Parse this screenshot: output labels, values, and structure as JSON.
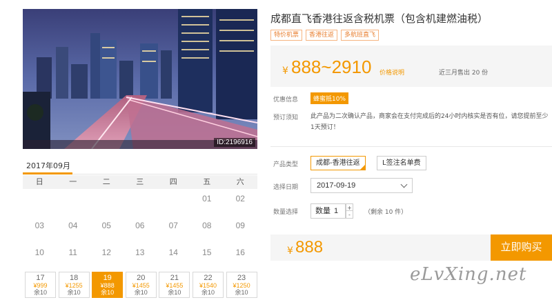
{
  "hero": {
    "image_id": "ID:2196916"
  },
  "calendar": {
    "month": "2017年09月",
    "weekdays": [
      "日",
      "一",
      "二",
      "三",
      "四",
      "五",
      "六"
    ],
    "rows": [
      [
        "",
        "",
        "",
        "",
        "",
        "01",
        "02"
      ],
      [
        "03",
        "04",
        "05",
        "06",
        "07",
        "08",
        "09"
      ],
      [
        "10",
        "11",
        "12",
        "13",
        "14",
        "15",
        "16"
      ]
    ],
    "price_days": [
      {
        "day": "17",
        "price": "¥999",
        "remain": "余10"
      },
      {
        "day": "18",
        "price": "¥1255",
        "remain": "余10"
      },
      {
        "day": "19",
        "price": "¥888",
        "remain": "余10"
      },
      {
        "day": "20",
        "price": "¥1455",
        "remain": "余10"
      },
      {
        "day": "21",
        "price": "¥1455",
        "remain": "余10"
      },
      {
        "day": "22",
        "price": "¥1540",
        "remain": "余10"
      },
      {
        "day": "23",
        "price": "¥1250",
        "remain": "余10"
      }
    ],
    "selected_day": "19"
  },
  "product": {
    "title": "成都直飞香港往返含税机票（包含机建燃油税）",
    "tags": [
      "特价机票",
      "香港往返",
      "多航班直飞"
    ],
    "price_symbol": "¥",
    "price_range": "888~2910",
    "price_note": "价格说明",
    "sold_text": "近三月售出 20 份",
    "promo_label": "优惠信息",
    "promo_badge": "蜂蜜抵10%",
    "booking_label": "预订须知",
    "booking_text": "此产品为二次确认产品，商家会在支付完成后的24小时内核实是否有位，请您提前至少1天预订！",
    "type_label": "产品类型",
    "type_options": [
      "成都-香港往返",
      "L签注名单费"
    ],
    "date_label": "选择日期",
    "date_value": "2017-09-19",
    "qty_label": "数量选择",
    "qty_prefix": "数量",
    "qty_value": "1",
    "qty_plus": "+",
    "qty_minus": "-",
    "stock_text": "（剩余 10 件）",
    "total_symbol": "¥",
    "total": "888",
    "buy_label": "立即购买"
  },
  "watermark": "eLvXing.net",
  "colors": {
    "accent": "#f39800",
    "tag_border": "#f6b37f"
  }
}
